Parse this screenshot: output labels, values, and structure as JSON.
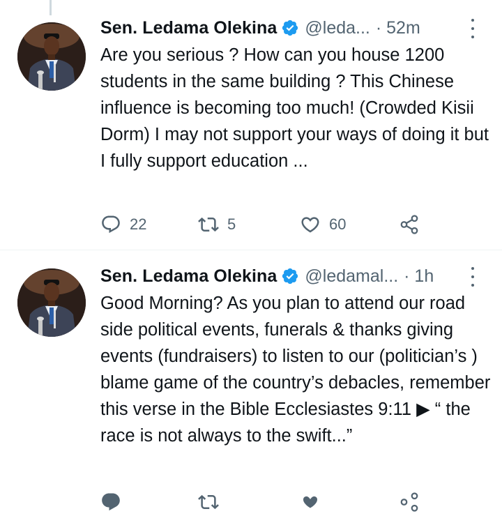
{
  "tweets": [
    {
      "author_name": "Sen. Ledama Olekina",
      "handle": "@leda...",
      "time": "· 52m",
      "text": "Are you serious ? How can you house 1200 students in the same building ? This Chinese influence is becoming too much! (Crowded Kisii Dorm) I may not support your ways of doing it but I fully support education ...",
      "reply_count": "22",
      "retweet_count": "5",
      "like_count": "60"
    },
    {
      "author_name": "Sen. Ledama Olekina",
      "handle": "@ledamal...",
      "time": "· 1h",
      "text": "Good Morning? As you plan to attend our road side political events, funerals & thanks giving events (fundraisers) to listen to our (politician’s ) blame game of the country’s debacles, remember this verse in the Bible Ecclesiastes 9:11 ▶ “ the race is not always to the swift...”",
      "reply_count": "",
      "retweet_count": "",
      "like_count": ""
    }
  ],
  "colors": {
    "text": "#0f1419",
    "secondary": "#536471",
    "verified_badge": "#1d9bf0",
    "divider": "#eff3f4",
    "thread_line": "#cfd9de"
  },
  "icons": [
    "verified-badge-icon",
    "more-icon",
    "reply-icon",
    "retweet-icon",
    "like-icon",
    "share-icon"
  ]
}
